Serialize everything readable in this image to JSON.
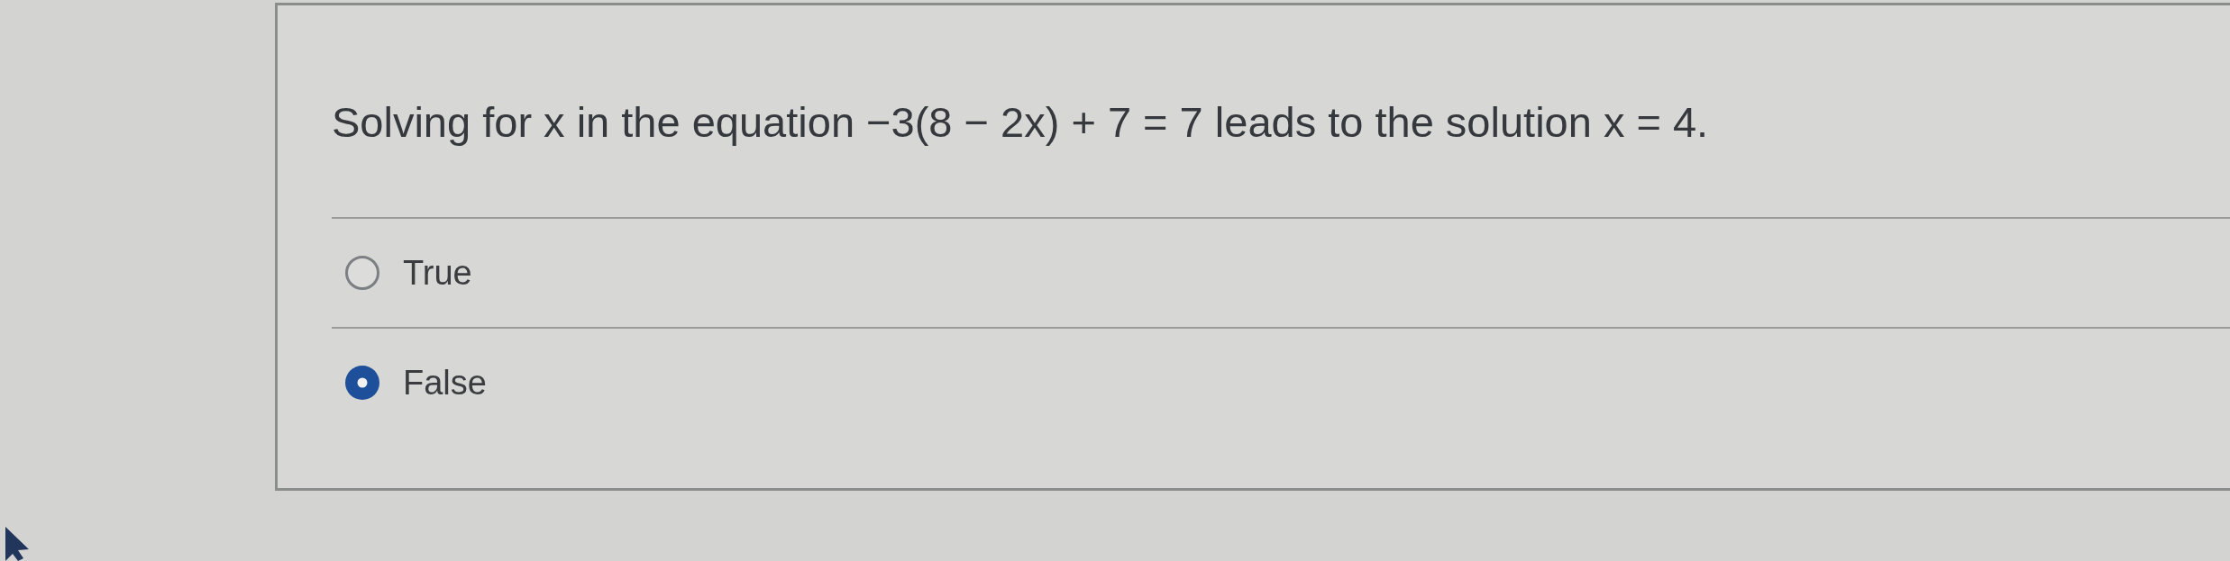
{
  "question": {
    "text": "Solving for x in the equation −3(8 − 2x) + 7 = 7 leads to the solution x = 4."
  },
  "options": [
    {
      "label": "True",
      "selected": false
    },
    {
      "label": "False",
      "selected": true
    }
  ]
}
